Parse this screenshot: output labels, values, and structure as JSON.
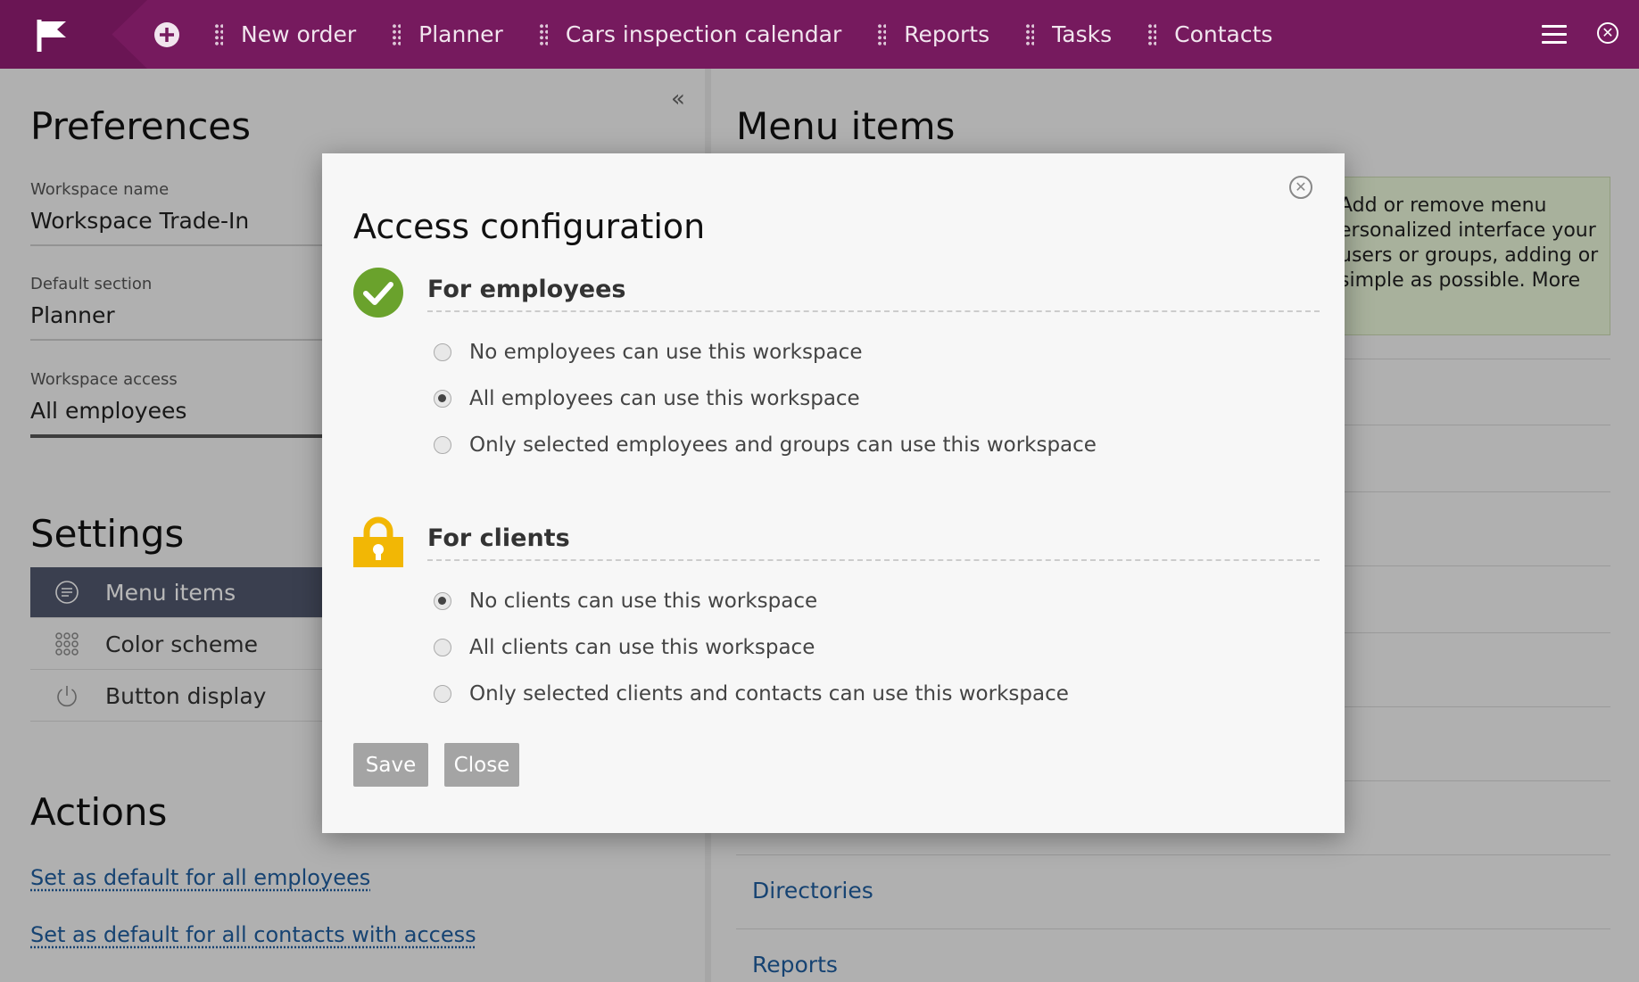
{
  "nav": {
    "items": [
      "New order",
      "Planner",
      "Cars inspection calendar",
      "Reports",
      "Tasks",
      "Contacts"
    ]
  },
  "left": {
    "collapse_icon": "«",
    "preferences_title": "Preferences",
    "fields": [
      {
        "label": "Workspace name",
        "value": "Workspace Trade-In"
      },
      {
        "label": "Default section",
        "value": "Planner"
      },
      {
        "label": "Workspace access",
        "value": "All employees"
      }
    ],
    "settings_title": "Settings",
    "settings_items": [
      "Menu items",
      "Color scheme",
      "Button display"
    ],
    "actions_title": "Actions",
    "links": [
      "Set as default for all employees",
      "Set as default for all contacts with access"
    ]
  },
  "right": {
    "title": "Menu items",
    "info_lines": [
      "Add or remove menu",
      "ersonalized interface your",
      "users or groups, adding or",
      "simple as possible. More"
    ],
    "items": [
      "Directories",
      "Reports"
    ]
  },
  "modal": {
    "title": "Access configuration",
    "employees": {
      "title": "For employees",
      "options": [
        "No employees can use this workspace",
        "All employees can use this workspace",
        "Only selected employees and groups can use this workspace"
      ],
      "selected": 1
    },
    "clients": {
      "title": "For clients",
      "options": [
        "No clients can use this workspace",
        "All clients can use this workspace",
        "Only selected clients and contacts can use this workspace"
      ],
      "selected": 0
    },
    "save_label": "Save",
    "close_label": "Close"
  },
  "colors": {
    "topbar": "#761a5e",
    "link": "#1f5d9e",
    "selected_item": "#51586e",
    "check_green": "#6aa22c",
    "lock_yellow": "#f2b705"
  }
}
